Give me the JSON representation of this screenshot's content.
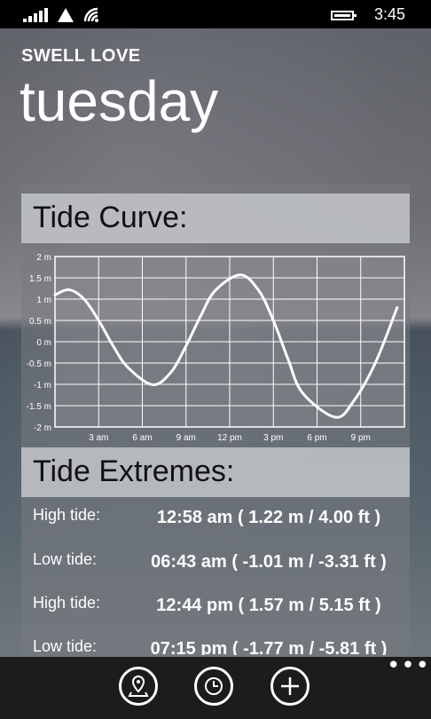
{
  "status_bar": {
    "time": "3:45"
  },
  "header": {
    "app_title": "SWELL LOVE",
    "page_title": "tuesday"
  },
  "tide_curve": {
    "heading": "Tide Curve:"
  },
  "tide_extremes": {
    "heading": "Tide Extremes:",
    "rows": [
      {
        "label": "High tide:",
        "value": "12:58 am ( 1.22 m / 4.00 ft )"
      },
      {
        "label": "Low tide:",
        "value": "06:43 am ( -1.01 m / -3.31 ft )"
      },
      {
        "label": "High tide:",
        "value": "12:44 pm ( 1.57 m / 5.15 ft )"
      },
      {
        "label": "Low tide:",
        "value": "07:15 pm ( -1.77 m / -5.81 ft )"
      }
    ]
  },
  "chart_data": {
    "type": "line",
    "title": "Tide Curve:",
    "xlabel": "",
    "ylabel": "",
    "ylim": [
      -2,
      2
    ],
    "xlim": [
      0,
      24
    ],
    "yticks": [
      "2 m",
      "1.5 m",
      "1 m",
      "0.5 m",
      "0 m",
      "-0.5 m",
      "-1 m",
      "-1.5 m",
      "-2 m"
    ],
    "xticks": [
      {
        "hour": 3,
        "label": "3 am"
      },
      {
        "hour": 6,
        "label": "6 am"
      },
      {
        "hour": 9,
        "label": "9 am"
      },
      {
        "hour": 12,
        "label": "12 pm"
      },
      {
        "hour": 15,
        "label": "3 pm"
      },
      {
        "hour": 18,
        "label": "6 pm"
      },
      {
        "hour": 21,
        "label": "9 pm"
      }
    ],
    "grid": true,
    "series": [
      {
        "x": [
          0,
          0.97,
          2,
          3,
          4,
          5,
          6.72,
          8,
          9,
          10,
          11,
          12.73,
          14,
          15,
          16,
          17,
          19.25,
          20.5,
          22,
          23.5
        ],
        "y": [
          1.1,
          1.22,
          1.0,
          0.5,
          -0.1,
          -0.6,
          -1.01,
          -0.7,
          -0.1,
          0.6,
          1.2,
          1.57,
          1.2,
          0.5,
          -0.4,
          -1.2,
          -1.77,
          -1.4,
          -0.5,
          0.8
        ]
      }
    ]
  },
  "app_bar": {
    "buttons": [
      {
        "name": "map-pin-button",
        "icon": "map-pin-icon"
      },
      {
        "name": "clock-button",
        "icon": "clock-icon"
      },
      {
        "name": "add-button",
        "icon": "plus-icon"
      }
    ],
    "more": "•••"
  }
}
